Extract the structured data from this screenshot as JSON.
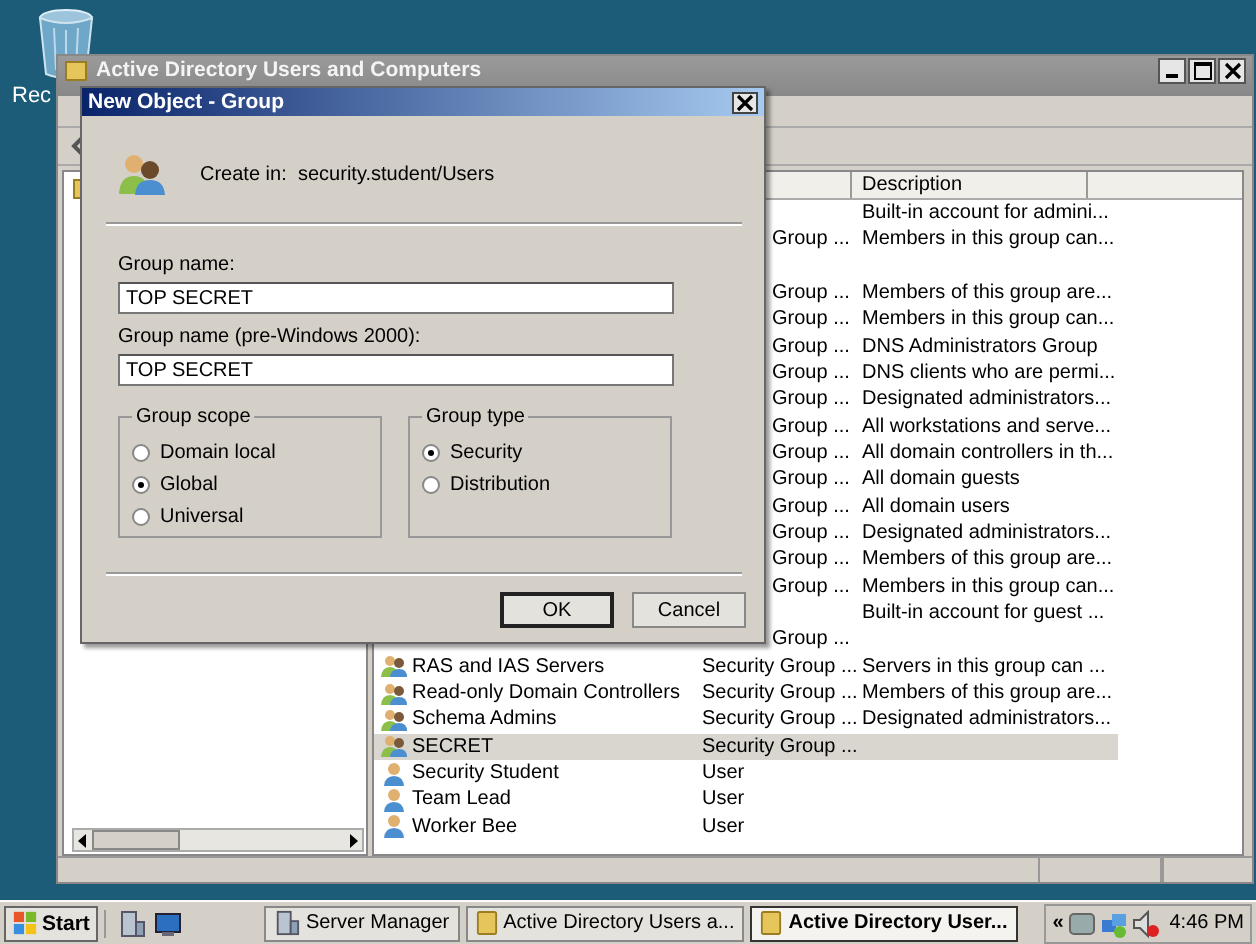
{
  "desktop": {
    "icon_label": "Rec"
  },
  "main_window": {
    "title": "Active Directory Users and Computers",
    "list": {
      "columns": [
        "Description"
      ],
      "rows": [
        {
          "kind": "covered",
          "description": "Built-in account for admini...",
          "selected": false
        },
        {
          "kind": "covered",
          "type": "Group ...",
          "description": "Members in this group can...",
          "selected": false
        },
        {
          "kind": "covered",
          "selected": false
        },
        {
          "kind": "covered",
          "type": "Group ...",
          "description": "Members of this group are...",
          "selected": false
        },
        {
          "kind": "covered",
          "type": "Group ...",
          "description": "Members in this group can...",
          "selected": false
        },
        {
          "kind": "covered",
          "type": "Group ...",
          "description": "DNS Administrators Group",
          "selected": false
        },
        {
          "kind": "covered",
          "type": "Group ...",
          "description": "DNS clients who are permi...",
          "selected": false
        },
        {
          "kind": "covered",
          "type": "Group ...",
          "description": "Designated administrators...",
          "selected": false
        },
        {
          "kind": "covered",
          "type": "Group ...",
          "description": "All workstations and serve...",
          "selected": false
        },
        {
          "kind": "covered",
          "type": "Group ...",
          "description": "All domain controllers in th...",
          "selected": false
        },
        {
          "kind": "covered",
          "type": "Group ...",
          "description": "All domain guests",
          "selected": false
        },
        {
          "kind": "covered",
          "type": "Group ...",
          "description": "All domain users",
          "selected": false
        },
        {
          "kind": "covered",
          "type": "Group ...",
          "description": "Designated administrators...",
          "selected": false
        },
        {
          "kind": "covered",
          "type": "Group ...",
          "description": "Members of this group are...",
          "selected": false
        },
        {
          "kind": "covered",
          "type": "Group ...",
          "description": "Members in this group can...",
          "selected": false
        },
        {
          "kind": "covered",
          "description": "Built-in account for guest ...",
          "selected": false
        },
        {
          "kind": "covered",
          "type": "Group ...",
          "selected": false
        },
        {
          "kind": "group",
          "name": "RAS and IAS Servers",
          "type": "Security Group ...",
          "description": "Servers in this group can ...",
          "selected": false
        },
        {
          "kind": "group",
          "name": "Read-only Domain Controllers",
          "type": "Security Group ...",
          "description": "Members of this group are...",
          "selected": false
        },
        {
          "kind": "group",
          "name": "Schema Admins",
          "type": "Security Group ...",
          "description": "Designated administrators...",
          "selected": false
        },
        {
          "kind": "group",
          "name": "SECRET",
          "type": "Security Group ...",
          "selected": true
        },
        {
          "kind": "user",
          "name": "Security Student",
          "type": "User",
          "selected": false
        },
        {
          "kind": "user",
          "name": "Team Lead",
          "type": "User",
          "selected": false
        },
        {
          "kind": "user",
          "name": "Worker Bee",
          "type": "User",
          "selected": false
        }
      ]
    }
  },
  "dialog": {
    "title": "New Object - Group",
    "create_in_label": "Create in:",
    "create_in_path": "security.student/Users",
    "fields": [
      {
        "label": "Group name:",
        "value": "TOP SECRET"
      },
      {
        "label": "Group name (pre-Windows 2000):",
        "value": "TOP SECRET"
      }
    ],
    "groups": [
      {
        "title": "Group scope",
        "options": [
          {
            "label": "Domain local",
            "selected": false
          },
          {
            "label": "Global",
            "selected": true
          },
          {
            "label": "Universal",
            "selected": false
          }
        ]
      },
      {
        "title": "Group type",
        "options": [
          {
            "label": "Security",
            "selected": true
          },
          {
            "label": "Distribution",
            "selected": false
          }
        ]
      }
    ],
    "buttons": [
      {
        "label": "OK",
        "default": true
      },
      {
        "label": "Cancel",
        "default": false
      }
    ]
  },
  "taskbar": {
    "start": "Start",
    "tasks": [
      {
        "label": "Server Manager",
        "selected": false
      },
      {
        "label": "Active Directory Users a...",
        "selected": false
      },
      {
        "label": "Active Directory User...",
        "selected": true
      }
    ],
    "chevron": "«",
    "time": "4:46 PM"
  }
}
